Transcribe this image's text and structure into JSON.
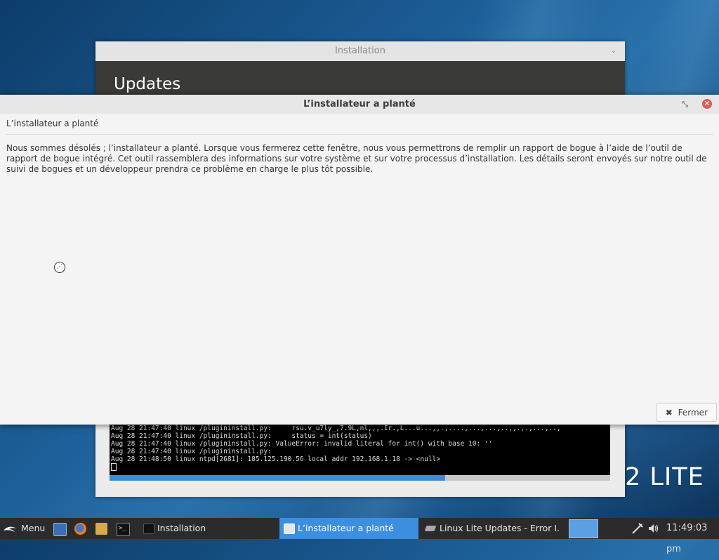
{
  "desktop": {
    "brand_text": "2 LITE"
  },
  "installer": {
    "title": "Installation",
    "minimize_glyph": "⌄",
    "heading": "Updates",
    "terminal_lines": [
      "Aug 28 21:47:40 linux /plugininstall.py:     rsu.v_u7ly_,7.9L,nl,,,.Ir.,L...u...,,.,....,...,...,..,,.,.,...,..,",
      "Aug 28 21:47:40 linux /plugininstall.py:     status = int(status)",
      "Aug 28 21:47:40 linux /plugininstall.py: ValueError: invalid literal for int() with base 10: ''",
      "Aug 28 21:47:40 linux /plugininstall.py:",
      "Aug 28 21:48:50 linux ntpd[2681]: 185.125.190.56 local addr 192.168.1.18 -> <null>"
    ],
    "progress_fraction": 0.67
  },
  "crash_dialog": {
    "title": "L’installateur a planté",
    "restore_glyph": "⤡",
    "close_glyph": "✕",
    "subtitle": "L’installateur a planté",
    "message": "Nous sommes désolés ; l’installateur a planté. Lorsque vous fermerez cette fenêtre, nous vous permettrons de remplir un rapport de bogue à l’aide de l’outil de rapport de bogue intégré. Cet outil rassemblera des informations sur votre système et sur votre processus d’installation. Les détails seront envoyés sur notre outil de suivi de bogues et un développeur prendra ce problème en charge le plus tôt possible.",
    "close_button_glyph": "✖",
    "close_button_label": "Fermer"
  },
  "taskbar": {
    "menu_label": "Menu",
    "launchers": [
      "desktop-icon",
      "firefox-icon",
      "files-icon",
      "terminal-icon"
    ],
    "tasks": [
      {
        "label": "Installation",
        "active": false
      },
      {
        "label": "L’installateur a planté",
        "active": true
      },
      {
        "label": "Linux Lite Updates - Error I...",
        "active": false
      }
    ],
    "clock": "11:49:03 pm",
    "colors": {
      "active_task": "#3d8ee0",
      "bar": "#2b2b2b"
    }
  }
}
